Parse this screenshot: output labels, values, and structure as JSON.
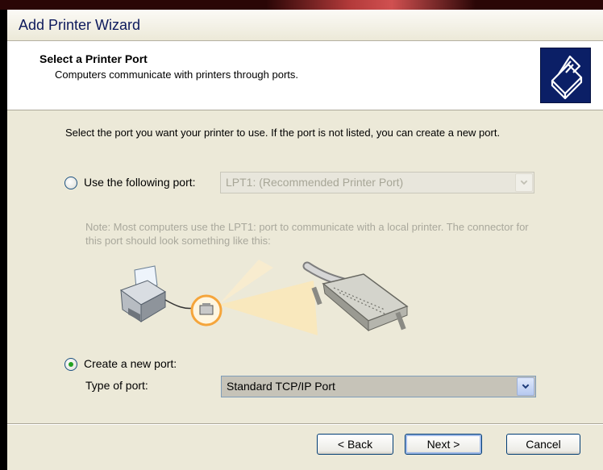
{
  "window": {
    "title": "Add Printer Wizard"
  },
  "header": {
    "title": "Select a Printer Port",
    "subtitle": "Computers communicate with printers through ports.",
    "icon": "printer-wizard-icon"
  },
  "body": {
    "instructions": "Select the port you want your printer to use.  If the port is not listed, you can create a new port.",
    "use_port": {
      "label": "Use the following port:",
      "selected": false,
      "value": "LPT1: (Recommended Printer Port)",
      "enabled": false
    },
    "note": "Note: Most computers use the LPT1: port to communicate with a local printer. The connector for this port should look something like this:",
    "create_port": {
      "label": "Create a new port:",
      "selected": true,
      "type_label": "Type of port:",
      "type_value": "Standard TCP/IP Port"
    }
  },
  "buttons": {
    "back": "< Back",
    "next": "Next >",
    "cancel": "Cancel"
  },
  "colors": {
    "header_icon_bg": "#0b1f66",
    "dialog_bg": "#ece9d8",
    "radio_dot": "#21a121",
    "title_text": "#0d1a5c"
  }
}
